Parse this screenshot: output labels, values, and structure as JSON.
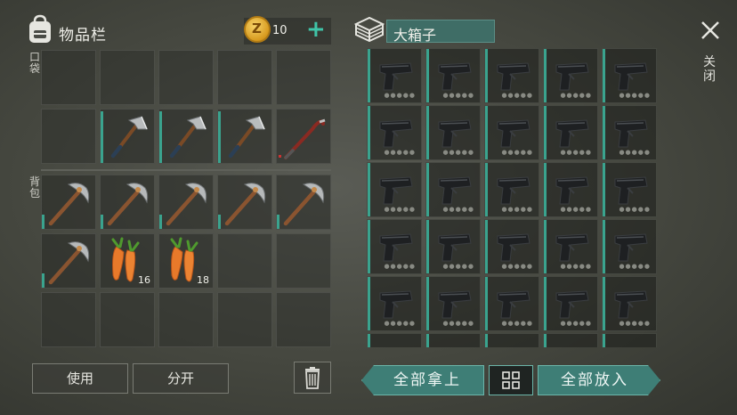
{
  "inventory": {
    "title": "物品栏",
    "coins": "10",
    "plus_label": "+",
    "pocket_label": "口袋",
    "backpack_label": "背包",
    "pocket_slots": [
      {
        "item": "",
        "count": ""
      },
      {
        "item": "",
        "count": ""
      },
      {
        "item": "",
        "count": ""
      },
      {
        "item": "",
        "count": ""
      },
      {
        "item": "",
        "count": ""
      },
      {
        "item": "",
        "count": ""
      },
      {
        "item": "hatchet",
        "count": ""
      },
      {
        "item": "hatchet",
        "count": ""
      },
      {
        "item": "hatchet",
        "count": ""
      },
      {
        "item": "crowbar",
        "count": ""
      }
    ],
    "backpack_slots": [
      {
        "item": "pickaxe",
        "count": ""
      },
      {
        "item": "pickaxe",
        "count": ""
      },
      {
        "item": "pickaxe",
        "count": ""
      },
      {
        "item": "pickaxe",
        "count": ""
      },
      {
        "item": "pickaxe",
        "count": ""
      },
      {
        "item": "pickaxe",
        "count": ""
      },
      {
        "item": "carrot",
        "count": "16"
      },
      {
        "item": "carrot",
        "count": "18"
      },
      {
        "item": "",
        "count": ""
      },
      {
        "item": "",
        "count": ""
      },
      {
        "item": "",
        "count": ""
      },
      {
        "item": "",
        "count": ""
      },
      {
        "item": "",
        "count": ""
      },
      {
        "item": "",
        "count": ""
      },
      {
        "item": "",
        "count": ""
      }
    ]
  },
  "container": {
    "title": "大箱子",
    "item": "pistol"
  },
  "close_label": "关闭",
  "buttons": {
    "use": "使用",
    "split": "分开",
    "take_all": "全部拿上",
    "put_all": "全部放入"
  },
  "icons": [
    "backpack-icon",
    "coin-icon",
    "box-icon",
    "close-icon",
    "trash-icon",
    "grid-icon"
  ],
  "colors": {
    "accent": "#3e7e76",
    "durability": "#3aa38e"
  }
}
